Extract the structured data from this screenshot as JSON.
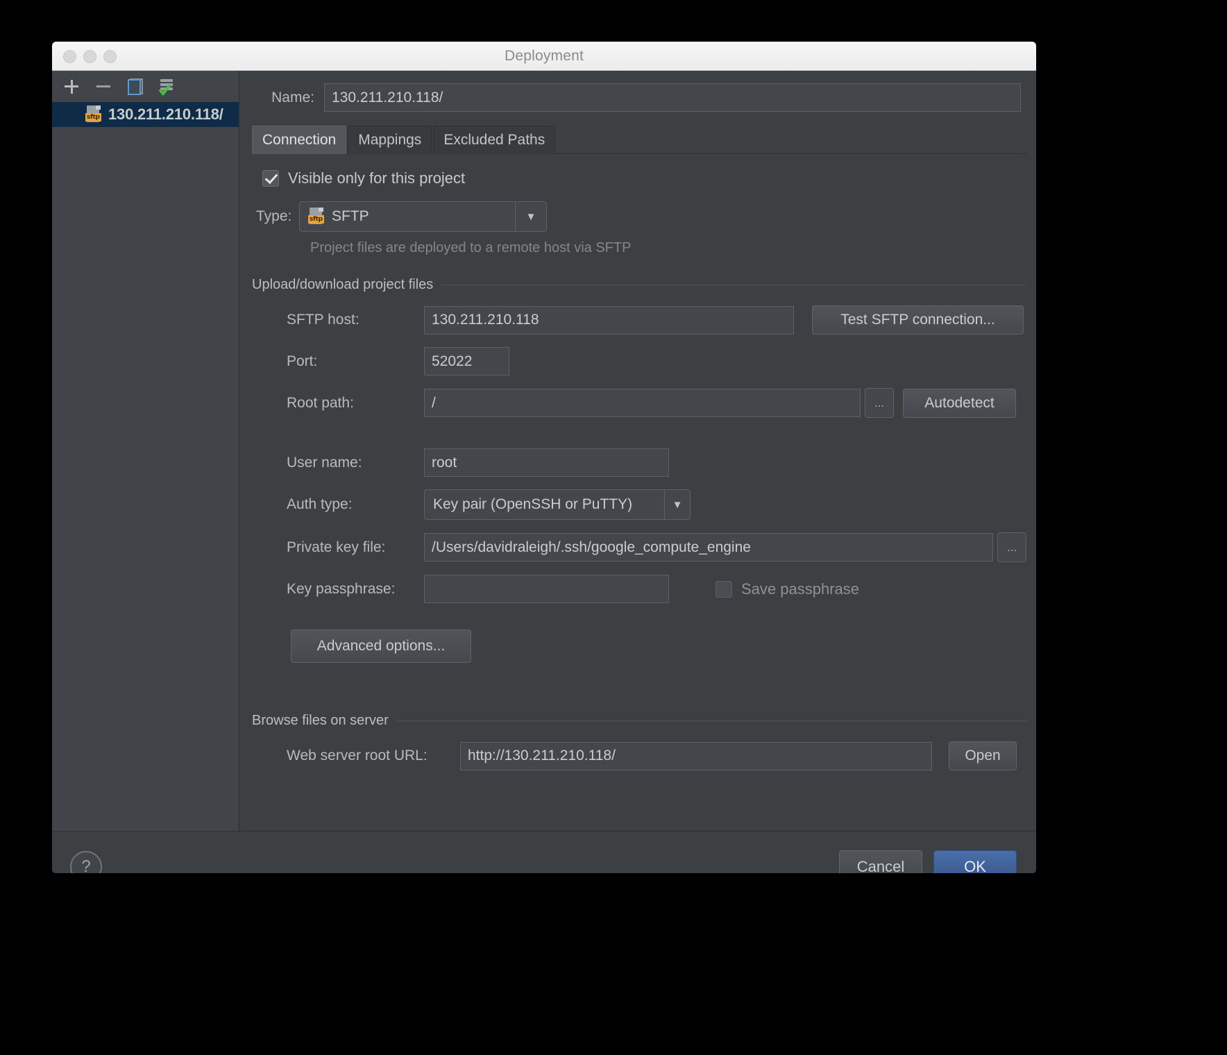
{
  "window": {
    "title": "Deployment"
  },
  "sidebar": {
    "toolbar": {
      "add_label": "+",
      "remove_label": "−",
      "copy_label": "Copy",
      "test_label": "Test"
    },
    "items": [
      {
        "label": "130.211.210.118/",
        "icon": "sftp-icon",
        "badge": "sftp",
        "selected": true
      }
    ]
  },
  "form": {
    "name_label": "Name:",
    "name_value": "130.211.210.118/",
    "tabs": [
      {
        "label": "Connection",
        "active": true
      },
      {
        "label": "Mappings",
        "active": false
      },
      {
        "label": "Excluded Paths",
        "active": false
      }
    ],
    "visible_only_label": "Visible only for this project",
    "visible_only_checked": true,
    "type_label": "Type:",
    "type_value": "SFTP",
    "type_badge": "sftp",
    "type_hint": "Project files are deployed to a remote host via SFTP",
    "upload_group_title": "Upload/download project files",
    "sftp_host_label": "SFTP host:",
    "sftp_host_value": "130.211.210.118",
    "test_connection_label": "Test SFTP connection...",
    "port_label": "Port:",
    "port_value": "52022",
    "root_path_label": "Root path:",
    "root_path_value": "/",
    "browse_label": "...",
    "autodetect_label": "Autodetect",
    "user_name_label": "User name:",
    "user_name_value": "root",
    "auth_type_label": "Auth type:",
    "auth_type_value": "Key pair (OpenSSH or PuTTY)",
    "private_key_label": "Private key file:",
    "private_key_value": "/Users/davidraleigh/.ssh/google_compute_engine",
    "private_key_browse_label": "...",
    "key_passphrase_label": "Key passphrase:",
    "key_passphrase_value": "",
    "save_passphrase_label": "Save passphrase",
    "save_passphrase_checked": false,
    "advanced_options_label": "Advanced options...",
    "browse_group_title": "Browse files on server",
    "web_url_label": "Web server root URL:",
    "web_url_value": "http://130.211.210.118/",
    "open_label": "Open"
  },
  "footer": {
    "help_label": "?",
    "cancel_label": "Cancel",
    "ok_label": "OK"
  },
  "colors": {
    "accent": "#37548a",
    "selection": "#0e2c47",
    "badge": "#e8a33d",
    "window_bg": "#3c4043"
  }
}
